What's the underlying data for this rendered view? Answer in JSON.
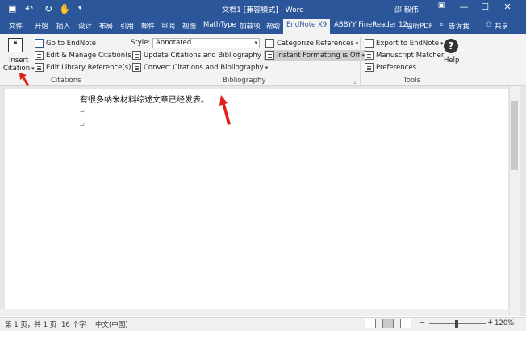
{
  "titlebar": {
    "save_icon": "save-icon",
    "undo_icon": "undo-icon",
    "redo_icon": "redo-icon",
    "touch_icon": "touch-mode-icon",
    "title": "文档1 [兼容模式] - Word",
    "user": "邵 毅伟",
    "minimize": "—",
    "restore": "☐",
    "close": "✕",
    "ribbon_options": "▣"
  },
  "tabs": {
    "file": "文件",
    "home": "开始",
    "insert": "插入",
    "design": "设计",
    "layout": "布局",
    "references": "引用",
    "mailings": "邮件",
    "review": "审阅",
    "view": "视图",
    "mathtype": "MathType",
    "addins": "加载项",
    "help": "帮助",
    "endnote": "EndNote X9",
    "abbyy": "ABBYY FineReader 12",
    "foxit": "福昕PDF",
    "tellme": "告诉我",
    "share": "共享"
  },
  "ribbon": {
    "insert_citation_1": "Insert",
    "insert_citation_2": "Citation",
    "go_to_endnote": "Go to EndNote",
    "edit_manage": "Edit & Manage Citation(s)",
    "edit_library": "Edit Library Reference(s)",
    "citations_group": "Citations",
    "style_label": "Style:",
    "style_value": "Annotated",
    "update_citations": "Update Citations and Bibliography",
    "convert_citations": "Convert Citations and Bibliography",
    "categorize": "Categorize References",
    "instant_formatting": "Instant Formatting is Off",
    "bibliography_group": "Bibliography",
    "export_endnote": "Export to EndNote",
    "manuscript_matcher": "Manuscript Matcher",
    "preferences": "Preferences",
    "help": "Help",
    "tools_group": "Tools"
  },
  "document": {
    "line1": "有很多纳米材料综述文章已经发表。",
    "pilcrow": "↵"
  },
  "status": {
    "page": "第 1 页，共 1 页",
    "words": "16 个字",
    "language": "中文(中国)",
    "zoom_minus": "−",
    "zoom_plus": "+",
    "zoom": "120%"
  },
  "colors": {
    "word_blue": "#2b579a",
    "arrow_red": "#e0201a"
  }
}
